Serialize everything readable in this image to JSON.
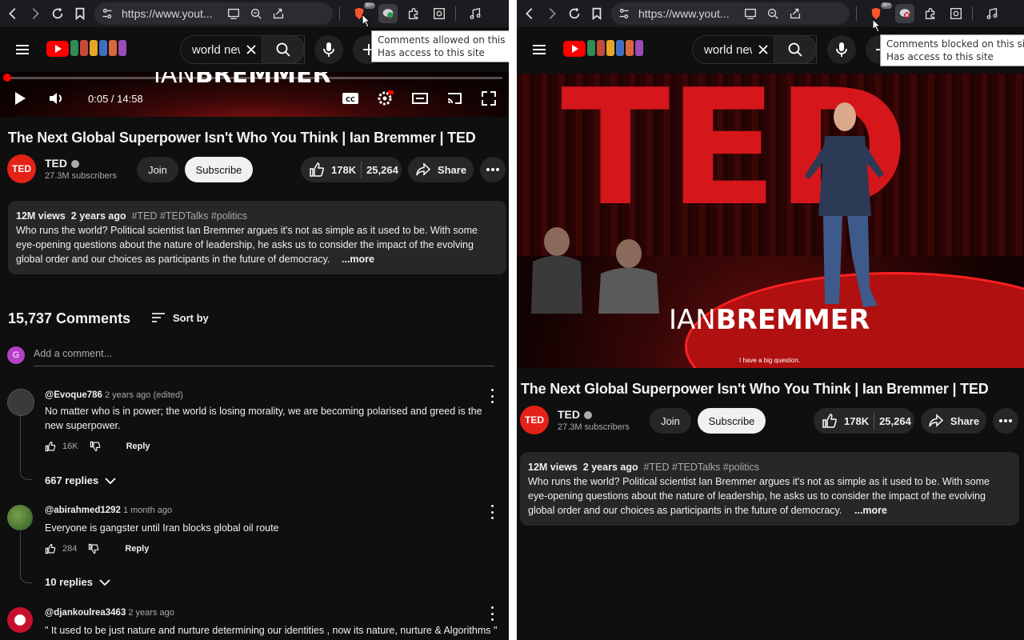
{
  "browser": {
    "url": "https://www.yout...",
    "brave_badge": "99+"
  },
  "header": {
    "search_query": "world news"
  },
  "left": {
    "tooltip_line1": "Comments allowed on this site",
    "tooltip_line2": "Has access to this site",
    "player": {
      "time": "0:05 / 14:58",
      "speaker_first": "IAN",
      "speaker_last": "BREMMER",
      "progress": 0.006
    }
  },
  "right": {
    "tooltip_line1": "Comments blocked on this site",
    "tooltip_line2": "Has access to this site",
    "player": {
      "ted_text": "TED",
      "speaker_first": "IAN",
      "speaker_last": "BREMMER",
      "caption": "I have a big question."
    }
  },
  "video": {
    "title": "The Next Global Superpower Isn't Who You Think | Ian Bremmer | TED",
    "channel": "TED",
    "avatar_text": "TED",
    "subscribers": "27.3M subscribers",
    "join": "Join",
    "subscribe": "Subscribe",
    "likes": "178K",
    "comments_count_pill": "25,264",
    "share": "Share",
    "views": "12M views",
    "age": "2 years ago",
    "tags": "#TED #TEDTalks #politics",
    "description": "Who runs the world? Political scientist Ian Bremmer argues it's not as simple as it used to be. With some eye-opening questions about the nature of leadership, he asks us to consider the impact of the evolving global order and our choices as participants in the future of democracy.",
    "more": "...more"
  },
  "comments": {
    "header": "15,737 Comments",
    "sort_by": "Sort by",
    "add_avatar": "G",
    "add_placeholder": "Add a comment...",
    "items": [
      {
        "author": "@Evoque786",
        "time": "2 years ago (edited)",
        "text": "No matter who is in power; the world is losing morality, we are becoming polarised and greed is the new superpower.",
        "likes": "16K",
        "reply": "Reply",
        "replies": "667 replies"
      },
      {
        "author": "@abirahmed1292",
        "time": "1 month ago",
        "text": "Everyone is gangster until Iran blocks global oil route",
        "likes": "284",
        "reply": "Reply",
        "replies": "10 replies"
      },
      {
        "author": "@djankoulrea3463",
        "time": "2 years ago",
        "text": "\" It used to be just nature and nurture determining our identities , now its nature, nurture & Algorithms \""
      }
    ]
  },
  "colors": {
    "background": "#0f0f0f",
    "accent_red": "#ff0000",
    "pill": "#272727"
  }
}
